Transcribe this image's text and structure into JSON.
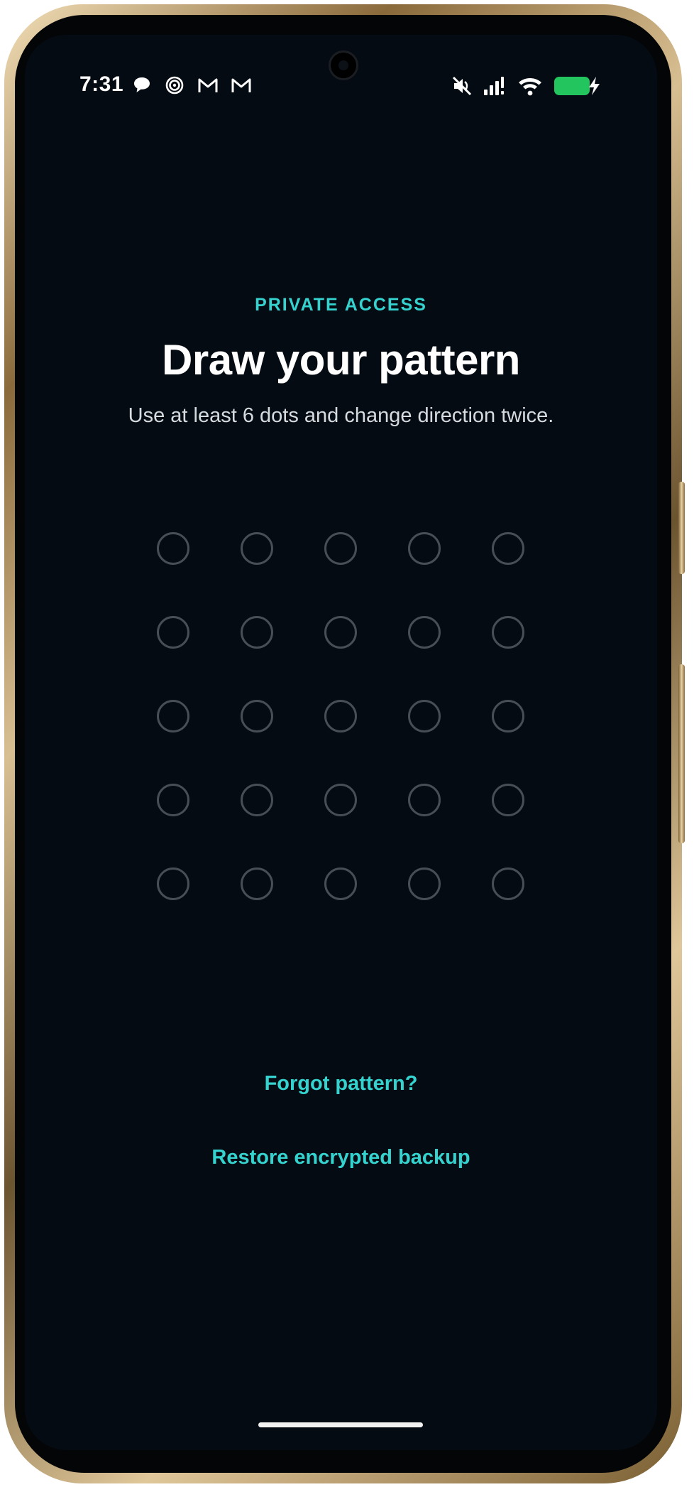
{
  "status_bar": {
    "time": "7:31",
    "left_icons": [
      "chat-bubble-icon",
      "spiral-icon",
      "gmail-icon",
      "gmail-icon"
    ],
    "right_icons": [
      "mute-icon",
      "signal-icon",
      "wifi-icon",
      "battery-charging-icon"
    ],
    "battery_color": "#22c55e"
  },
  "header": {
    "eyebrow": "PRIVATE ACCESS",
    "title": "Draw your pattern",
    "subtitle": "Use at least 6 dots and change direction twice."
  },
  "pattern": {
    "rows": 5,
    "cols": 5
  },
  "actions": {
    "forgot_label": "Forgot pattern?",
    "restore_label": "Restore encrypted backup"
  },
  "colors": {
    "accent": "#35d3cf",
    "background": "#050b12",
    "dot_outline": "#474e56"
  }
}
